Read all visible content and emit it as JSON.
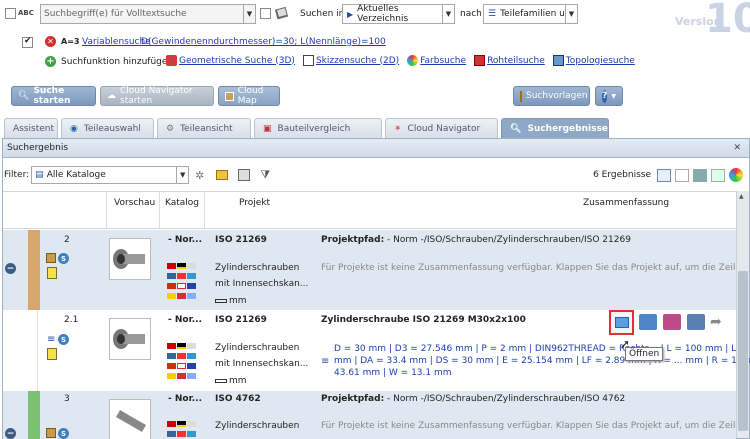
{
  "search": {
    "abc_label": "ABC",
    "fulltext_placeholder": "Suchbegriff(e) für Volltextsuche",
    "search_in_label": "Suchen in",
    "search_in_value": "Aktuelles Verzeichnis",
    "nach_label": "nach",
    "nach_value": "Teilefamilien und",
    "version_label": "Version",
    "version_number": "10"
  },
  "variable_row": {
    "op": "A=3",
    "link": "Variablensuche",
    "expr": "D(Gewindenenndurchmesser)=30; L(Nennlänge)=100"
  },
  "add_row": {
    "label": "Suchfunktion hinzufügen:",
    "items": [
      "Geometrische Suche (3D)",
      "Skizzensuche (2D)",
      "Farbsuche",
      "Rohteilsuche",
      "Topologiesuche"
    ]
  },
  "toolbar": {
    "start": "Suche starten",
    "cloud_nav": "Cloud Navigator starten",
    "cloud_map": "Cloud Map",
    "templates": "Suchvorlagen",
    "help": "?"
  },
  "tabs": [
    "Assistent",
    "Teileauswahl",
    "Teileansicht",
    "Bauteilvergleich",
    "Cloud Navigator",
    "Suchergebnisse"
  ],
  "results": {
    "title": "Suchergebnis",
    "filter_label": "Filter:",
    "filter_value": "Alle Kataloge",
    "count": "6 Ergebnisse",
    "columns": [
      "Vorschau",
      "Katalog",
      "Projekt",
      "Zusammenfassung"
    ],
    "rows": [
      {
        "index": "2",
        "catalog": "- Nor...",
        "project": "ISO 21269",
        "desc1": "Zylinderschrauben",
        "desc2": "mit Innensechskan...",
        "unit": "mm",
        "summary_title": "Projektpfad:",
        "summary_path": " - Norm -/ISO/Schrauben/Zylinderschrauben/ISO 21269",
        "summary_note": "Für Projekte ist keine Zusammenfassung verfügbar. Klappen Sie das Projekt auf, um die Zeilen zu se"
      },
      {
        "index": "2.1",
        "catalog": "- Nor...",
        "project": "ISO 21269",
        "desc1": "Zylinderschrauben",
        "desc2": "mit Innensechskan...",
        "unit": "mm",
        "summary_title": "Zylinderschraube ISO 21269 M30x2x100",
        "line1": "D = 30 mm | D3 = 27.546 mm | P = 2 mm | DIN962THREAD = Rechts... | L = 100 mm | L",
        "line2": "mm | DA = 33.4 mm | DS = 30 mm | E = 25.154 mm | LF = 2.89 mm | R = ... mm | R = 1 mm | S",
        "line3": "43.61 mm | W = 13.1 mm",
        "tooltip": "Öffnen"
      },
      {
        "index": "3",
        "catalog": "- Nor...",
        "project": "ISO 4762",
        "desc1": "Zylinderschrauben",
        "summary_title": "Projektpfad:",
        "summary_path": " - Norm -/ISO/Schrauben/Zylinderschrauben/ISO 4762",
        "summary_note": "Für Projekte ist keine Zusammenfassung verfügbar. Klappen Sie das Projekt auf, um die Zeilen zu se"
      }
    ]
  },
  "colors": {
    "accent": "#7d98bd",
    "highlight": "#ffff66",
    "tooltip_border": "#e03030"
  }
}
